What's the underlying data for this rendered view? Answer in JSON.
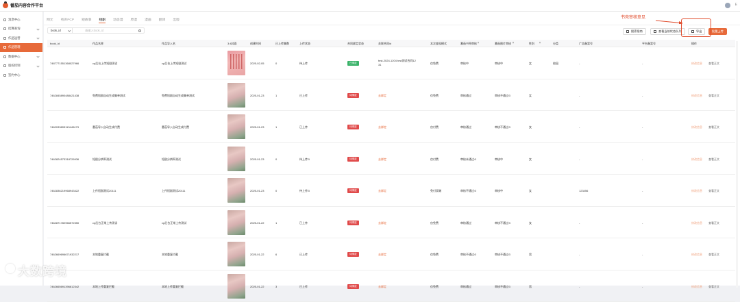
{
  "app": {
    "title": "番茄内容合作平台",
    "user": "E"
  },
  "sidebar": {
    "items": [
      {
        "label": "消息中心",
        "active": false,
        "chevron": false
      },
      {
        "label": "结算查询",
        "active": false,
        "chevron": true
      },
      {
        "label": "作品运营",
        "active": false,
        "chevron": true
      },
      {
        "label": "作品管理",
        "active": true,
        "chevron": false
      },
      {
        "label": "数据中心",
        "active": false,
        "chevron": true
      },
      {
        "label": "版权控制",
        "active": false,
        "chevron": true
      },
      {
        "label": "签约中心",
        "active": false,
        "chevron": false
      }
    ]
  },
  "tabs": [
    {
      "label": "网文",
      "active": false
    },
    {
      "label": "有声PCP",
      "active": false
    },
    {
      "label": "短故事",
      "active": false
    },
    {
      "label": "短剧",
      "active": true
    },
    {
      "label": "动态漫",
      "active": false
    },
    {
      "label": "原漫",
      "active": false
    },
    {
      "label": "漫画",
      "active": false
    },
    {
      "label": "翻译",
      "active": false
    },
    {
      "label": "出版",
      "active": false
    }
  ],
  "filter": {
    "select": "book_id",
    "placeholder": "请输入book_id"
  },
  "toolbar": {
    "guide": "搜索指南",
    "latest": "查看当前状态队列",
    "export": "导出",
    "upload": "批量上传"
  },
  "annotation": {
    "text": "书壳审核意见"
  },
  "table": {
    "headers": [
      "book_id",
      "作品名称",
      "作品导入名",
      "3:4封面",
      "创建时间",
      "已上传集数",
      "上传状态",
      "合同绑定状态",
      "关联合同id",
      "本次变现模式",
      "番茄书壳审核",
      "",
      "番茄图片审核",
      "",
      "性别",
      "",
      "分类",
      "广告备案号",
      "平台备案号",
      "操作"
    ],
    "rows": [
      {
        "id": "7487771551368027966",
        "name": "cp后台上传短剧测试",
        "import": "cp后台上传短剧测试",
        "cover": "red",
        "date": "2025-02-05",
        "eps": "0",
        "upload": "待上传",
        "bind": "已绑定",
        "bind_color": "green",
        "contract": "test-2024-1204  test测试合同12",
        "contract2": "31",
        "mode": "仅免费",
        "shell": "审核中",
        "img": "审核中",
        "gender": "女",
        "cat": "校园",
        "ad": "-",
        "plat": "-",
        "op1": "修改信息",
        "op2": "查看正文"
      },
      {
        "id": "7462845890488421438",
        "name": "免费短剧自动生成集单测试",
        "import": "免费短剧自动生成集单测试",
        "cover": "",
        "date": "2025-01-23",
        "eps": "1",
        "upload": "已上传",
        "bind": "待绑定",
        "bind_color": "red",
        "contract": "去绑定",
        "contract2": "",
        "mode": "仅免费",
        "shell": "审核通过",
        "img": "审核不通过⊙",
        "gender": "女",
        "cat": "",
        "ad": "-",
        "plat": "-",
        "op1": "修改信息",
        "op2": "查看正文"
      },
      {
        "id": "7462033893113449473",
        "name": "番茄导入自动生成付费",
        "import": "番茄导入自动生成付费",
        "cover": "",
        "date": "2025-01-23",
        "eps": "1",
        "upload": "已上传",
        "bind": "待绑定",
        "bind_color": "red",
        "contract": "去绑定",
        "contract2": "",
        "mode": "仅付费",
        "shell": "审核通过",
        "img": "审核不通过⊙",
        "gender": "女",
        "cat": "",
        "ad": "-",
        "plat": "-",
        "op1": "修改信息",
        "op2": "查看正文"
      },
      {
        "id": "7462824573318726936",
        "name": "短剧分辨率测试",
        "import": "短剧分辨率测试",
        "cover": "",
        "date": "2025-01-23",
        "eps": "0",
        "upload": "待上传⊙",
        "bind": "待绑定",
        "bind_color": "red",
        "contract": "去绑定",
        "contract2": "",
        "mode": "仅付费",
        "shell": "审核未通过⊙",
        "img": "审核中",
        "gender": "女",
        "cat": "",
        "ad": "-",
        "plat": "-",
        "op1": "修改信息",
        "op2": "查看正文"
      },
      {
        "id": "7462836219968943422",
        "name": "上传短剧测试20111",
        "import": "上传短剧测试20111",
        "cover": "",
        "date": "2025-01-23",
        "eps": "0",
        "upload": "待上传⊙",
        "bind": "待绑定",
        "bind_color": "red",
        "contract": "去绑定",
        "contract2": "",
        "mode": "免付双端",
        "shell": "审核不通过⊙",
        "img": "审核中",
        "gender": "女",
        "cat": "",
        "ad": "123456",
        "plat": "-",
        "op1": "修改信息",
        "op2": "查看正文"
      },
      {
        "id": "7462871782966572350",
        "name": "cp后台正常上传测试",
        "import": "cp后台正常上传测试",
        "cover": "",
        "date": "2025-01-22",
        "eps": "1",
        "upload": "已上传",
        "bind": "待绑定",
        "bind_color": "red",
        "contract": "去绑定",
        "contract2": "",
        "mode": "仅免费",
        "shell": "审核通过",
        "img": "审核不通过⊙",
        "gender": "女",
        "cat": "",
        "ad": "-",
        "plat": "-",
        "op1": "修改信息",
        "op2": "查看正文"
      },
      {
        "id": "7462669696671932217",
        "name": "本地重复拦截",
        "import": "本地重复拦截",
        "cover": "",
        "date": "2025-01-22",
        "eps": "6",
        "upload": "已上传",
        "bind": "待绑定",
        "bind_color": "red",
        "contract": "去绑定",
        "contract2": "",
        "mode": "仅免费",
        "shell": "审核不通过⊙",
        "img": "审核不通过⊙",
        "gender": "男",
        "cat": "",
        "ad": "-",
        "plat": "-",
        "op1": "修改信息",
        "op2": "查看正文"
      },
      {
        "id": "7462665691396612342",
        "name": "本地上传重复拦截",
        "import": "本地上传重复拦截",
        "cover": "",
        "date": "2025-01-22",
        "eps": "3",
        "upload": "已上传",
        "bind": "待绑定",
        "bind_color": "red",
        "contract": "去绑定",
        "contract2": "",
        "mode": "仅免费",
        "shell": "审核通过",
        "img": "审核不通过⊙",
        "gender": "男",
        "cat": "",
        "ad": "-",
        "plat": "-",
        "op1": "修改信息",
        "op2": "查看正文"
      }
    ]
  },
  "watermark": {
    "text": "大数跨境"
  }
}
